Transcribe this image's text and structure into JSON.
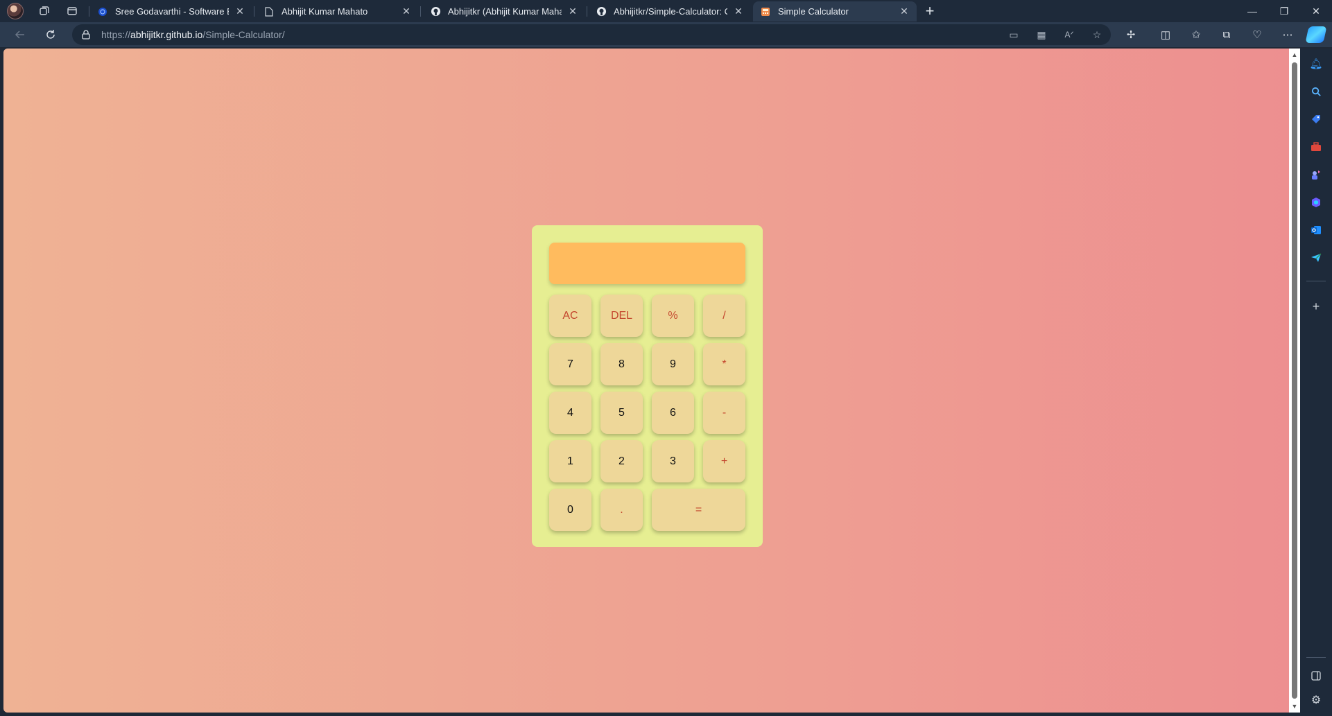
{
  "tabs": [
    {
      "title": "Sree Godavarthi - Software Engi",
      "favicon": "globe-icon",
      "active": false
    },
    {
      "title": "Abhijit Kumar Mahato",
      "favicon": "document-icon",
      "active": false
    },
    {
      "title": "Abhijitkr (Abhijit Kumar Mahato)",
      "favicon": "github-icon",
      "active": false
    },
    {
      "title": "Abhijitkr/Simple-Calculator: Calc",
      "favicon": "github-icon",
      "active": false
    },
    {
      "title": "Simple Calculator",
      "favicon": "calculator-icon",
      "active": true
    }
  ],
  "address": {
    "protocol": "https://",
    "host": "abhijitkr.github.io",
    "path": "/Simple-Calculator/"
  },
  "calculator": {
    "display_value": "",
    "keys": [
      {
        "label": "AC",
        "type": "operator"
      },
      {
        "label": "DEL",
        "type": "operator"
      },
      {
        "label": "%",
        "type": "operator"
      },
      {
        "label": "/",
        "type": "operator"
      },
      {
        "label": "7",
        "type": "digit"
      },
      {
        "label": "8",
        "type": "digit"
      },
      {
        "label": "9",
        "type": "digit"
      },
      {
        "label": "*",
        "type": "operator"
      },
      {
        "label": "4",
        "type": "digit"
      },
      {
        "label": "5",
        "type": "digit"
      },
      {
        "label": "6",
        "type": "digit"
      },
      {
        "label": "-",
        "type": "operator"
      },
      {
        "label": "1",
        "type": "digit"
      },
      {
        "label": "2",
        "type": "digit"
      },
      {
        "label": "3",
        "type": "digit"
      },
      {
        "label": "+",
        "type": "operator"
      },
      {
        "label": "0",
        "type": "digit"
      },
      {
        "label": ".",
        "type": "operator"
      },
      {
        "label": "=",
        "type": "operator"
      }
    ]
  },
  "colors": {
    "background_start": "#efb294",
    "background_end": "#ed8f90",
    "calculator_body": "#e6ee92",
    "display": "#ffbb5e",
    "key": "#eed799",
    "operator_text": "#c4472e"
  }
}
